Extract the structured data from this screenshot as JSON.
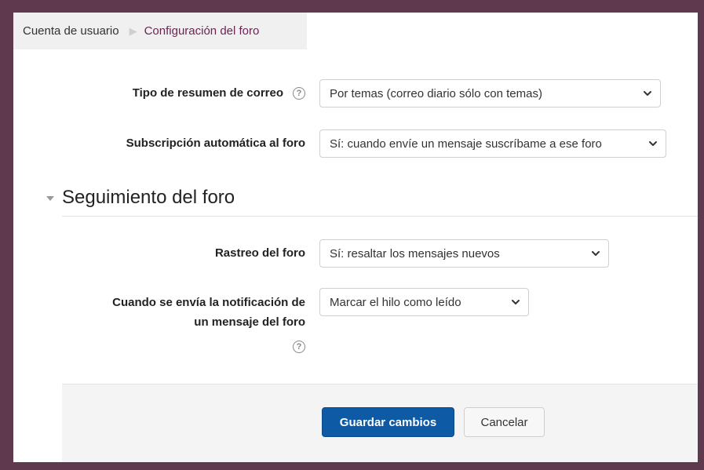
{
  "breadcrumb": {
    "items": [
      {
        "label": "Cuenta de usuario"
      },
      {
        "label": "Configuración del foro"
      }
    ]
  },
  "settings": {
    "digest_type": {
      "label": "Tipo de resumen de correo",
      "value": "Por temas (correo diario sólo con temas)",
      "help_icon": "question-circle-icon"
    },
    "auto_subscribe": {
      "label": "Subscripción automática al foro",
      "value": "Sí: cuando envíe un mensaje suscríbame a ese foro"
    }
  },
  "tracking_section": {
    "title": "Seguimiento del foro",
    "forum_tracking": {
      "label": "Rastreo del foro",
      "value": "Sí: resaltar los mensajes nuevos"
    },
    "notification": {
      "label_line1": "Cuando se envía la notificación de",
      "label_line2": "un mensaje del foro",
      "value": "Marcar el hilo como leído",
      "help_icon": "question-circle-icon"
    }
  },
  "buttons": {
    "save": "Guardar cambios",
    "cancel": "Cancelar"
  },
  "colors": {
    "outer_frame": "#5f3a4f",
    "link": "#6b2554",
    "primary_button": "#0e5aa5"
  }
}
